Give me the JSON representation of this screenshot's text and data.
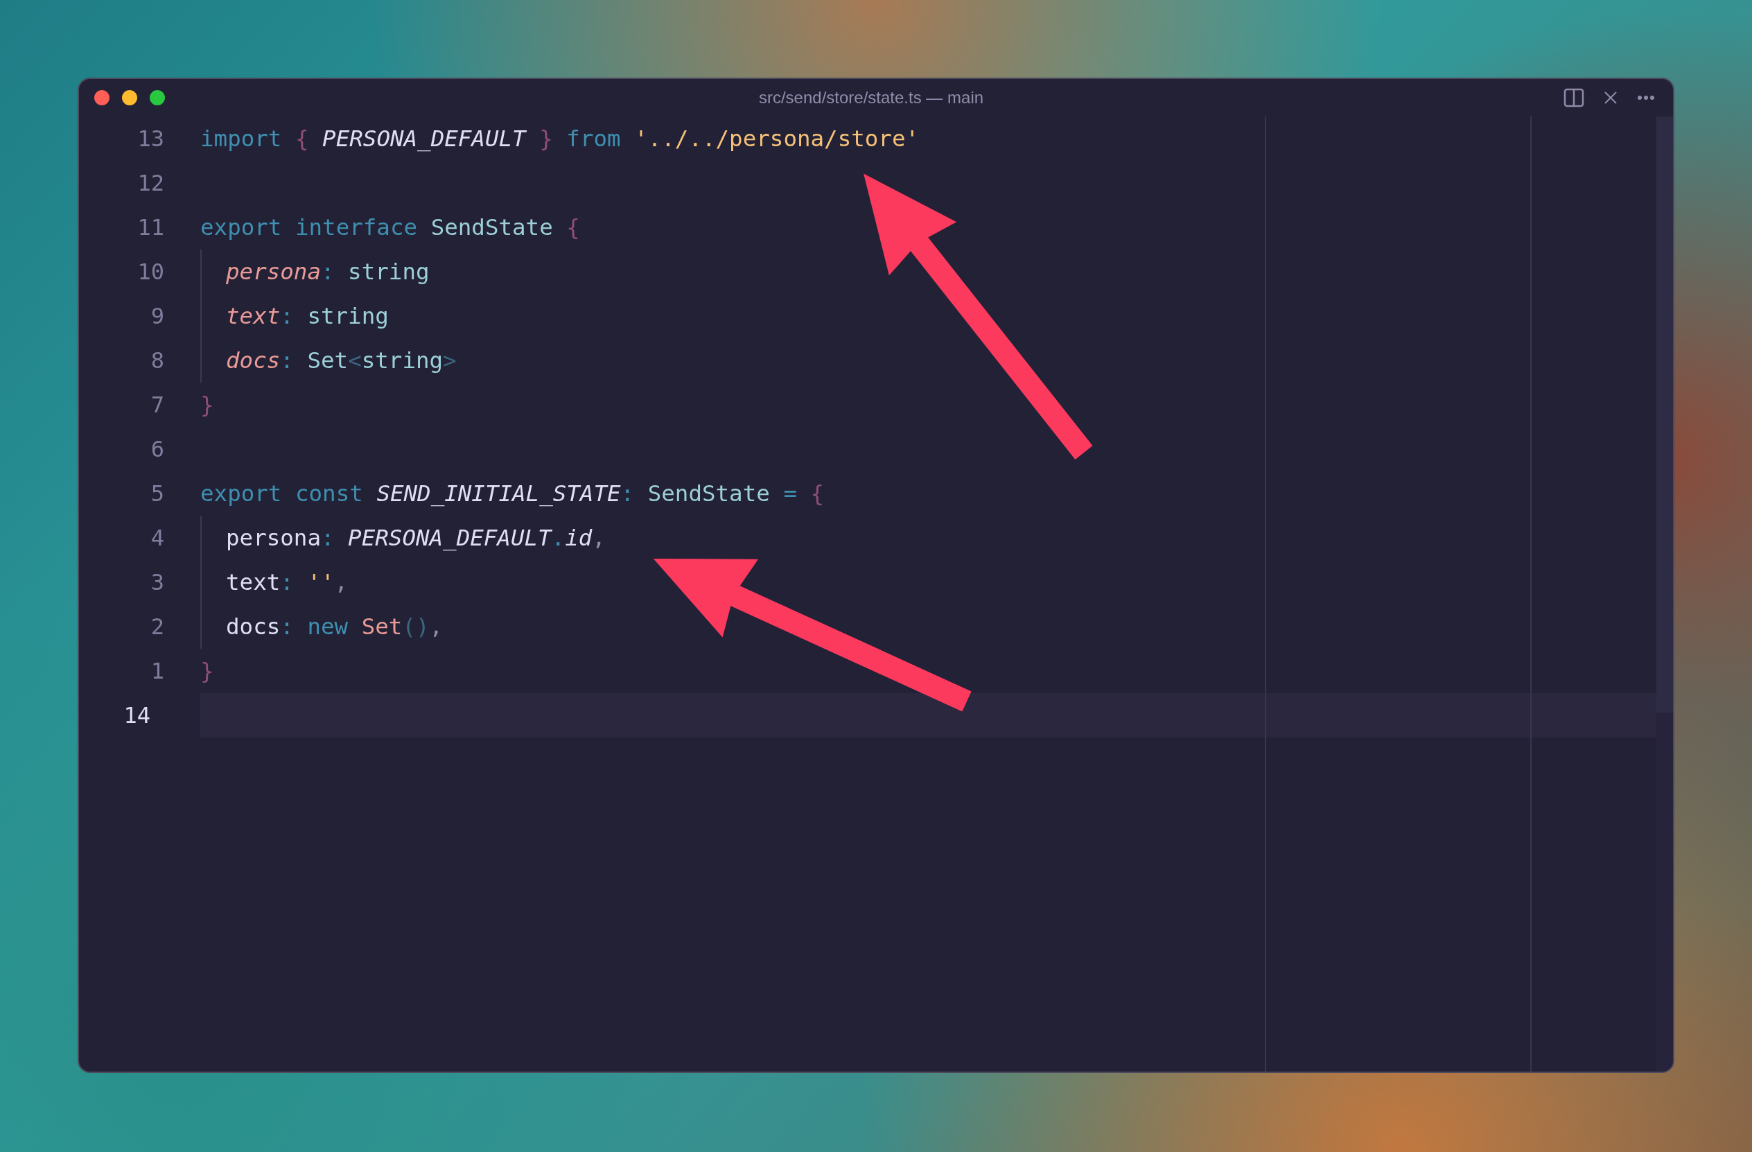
{
  "window": {
    "title": "src/send/store/state.ts — main"
  },
  "editor": {
    "lines": [
      {
        "number": "13",
        "current": false,
        "indented": false,
        "tokens": [
          {
            "kind": "kw",
            "text": "import "
          },
          {
            "kind": "brace",
            "text": "{ "
          },
          {
            "kind": "const",
            "text": "PERSONA_DEFAULT"
          },
          {
            "kind": "brace",
            "text": " } "
          },
          {
            "kind": "kw",
            "text": "from "
          },
          {
            "kind": "str",
            "text": "'../../persona/store'"
          }
        ]
      },
      {
        "number": "12",
        "current": false,
        "indented": false
      },
      {
        "number": "11",
        "current": false,
        "indented": false,
        "tokens": [
          {
            "kind": "kw",
            "text": "export "
          },
          {
            "kind": "kw",
            "text": "interface "
          },
          {
            "kind": "type",
            "text": "SendState "
          },
          {
            "kind": "brace",
            "text": "{"
          }
        ]
      },
      {
        "number": "10",
        "current": false,
        "indented": true,
        "tokens": [
          {
            "kind": "prop",
            "text": "persona"
          },
          {
            "kind": "punct",
            "text": ": "
          },
          {
            "kind": "type",
            "text": "string"
          }
        ]
      },
      {
        "number": "9",
        "current": false,
        "indented": true,
        "tokens": [
          {
            "kind": "prop",
            "text": "text"
          },
          {
            "kind": "punct",
            "text": ": "
          },
          {
            "kind": "type",
            "text": "string"
          }
        ]
      },
      {
        "number": "8",
        "current": false,
        "indented": true,
        "tokens": [
          {
            "kind": "prop",
            "text": "docs"
          },
          {
            "kind": "punct",
            "text": ": "
          },
          {
            "kind": "type",
            "text": "Set"
          },
          {
            "kind": "angle",
            "text": "<"
          },
          {
            "kind": "type",
            "text": "string"
          },
          {
            "kind": "angle",
            "text": ">"
          }
        ]
      },
      {
        "number": "7",
        "current": false,
        "indented": false,
        "tokens": [
          {
            "kind": "brace",
            "text": "}"
          }
        ]
      },
      {
        "number": "6",
        "current": false,
        "indented": false
      },
      {
        "number": "5",
        "current": false,
        "indented": false,
        "tokens": [
          {
            "kind": "kw",
            "text": "export "
          },
          {
            "kind": "kw",
            "text": "const "
          },
          {
            "kind": "const",
            "text": "SEND_INITIAL_STATE"
          },
          {
            "kind": "punct",
            "text": ": "
          },
          {
            "kind": "type",
            "text": "SendState "
          },
          {
            "kind": "punct",
            "text": "= "
          },
          {
            "kind": "brace",
            "text": "{"
          }
        ]
      },
      {
        "number": "4",
        "current": false,
        "indented": true,
        "tokens": [
          {
            "kind": "plain",
            "text": "persona"
          },
          {
            "kind": "punct",
            "text": ": "
          },
          {
            "kind": "const",
            "text": "PERSONA_DEFAULT"
          },
          {
            "kind": "punct",
            "text": "."
          },
          {
            "kind": "const",
            "text": "id"
          },
          {
            "kind": "comma",
            "text": ","
          }
        ]
      },
      {
        "number": "3",
        "current": false,
        "indented": true,
        "tokens": [
          {
            "kind": "plain",
            "text": "text"
          },
          {
            "kind": "punct",
            "text": ": "
          },
          {
            "kind": "str",
            "text": "''"
          },
          {
            "kind": "comma",
            "text": ","
          }
        ]
      },
      {
        "number": "2",
        "current": false,
        "indented": true,
        "tokens": [
          {
            "kind": "plain",
            "text": "docs"
          },
          {
            "kind": "punct",
            "text": ": "
          },
          {
            "kind": "kw",
            "text": "new "
          },
          {
            "kind": "cls",
            "text": "Set"
          },
          {
            "kind": "angle",
            "text": "()"
          },
          {
            "kind": "comma",
            "text": ","
          }
        ]
      },
      {
        "number": "1",
        "current": false,
        "indented": false,
        "tokens": [
          {
            "kind": "brace",
            "text": "}"
          }
        ]
      },
      {
        "number": "14",
        "current": true,
        "indented": false
      }
    ]
  }
}
